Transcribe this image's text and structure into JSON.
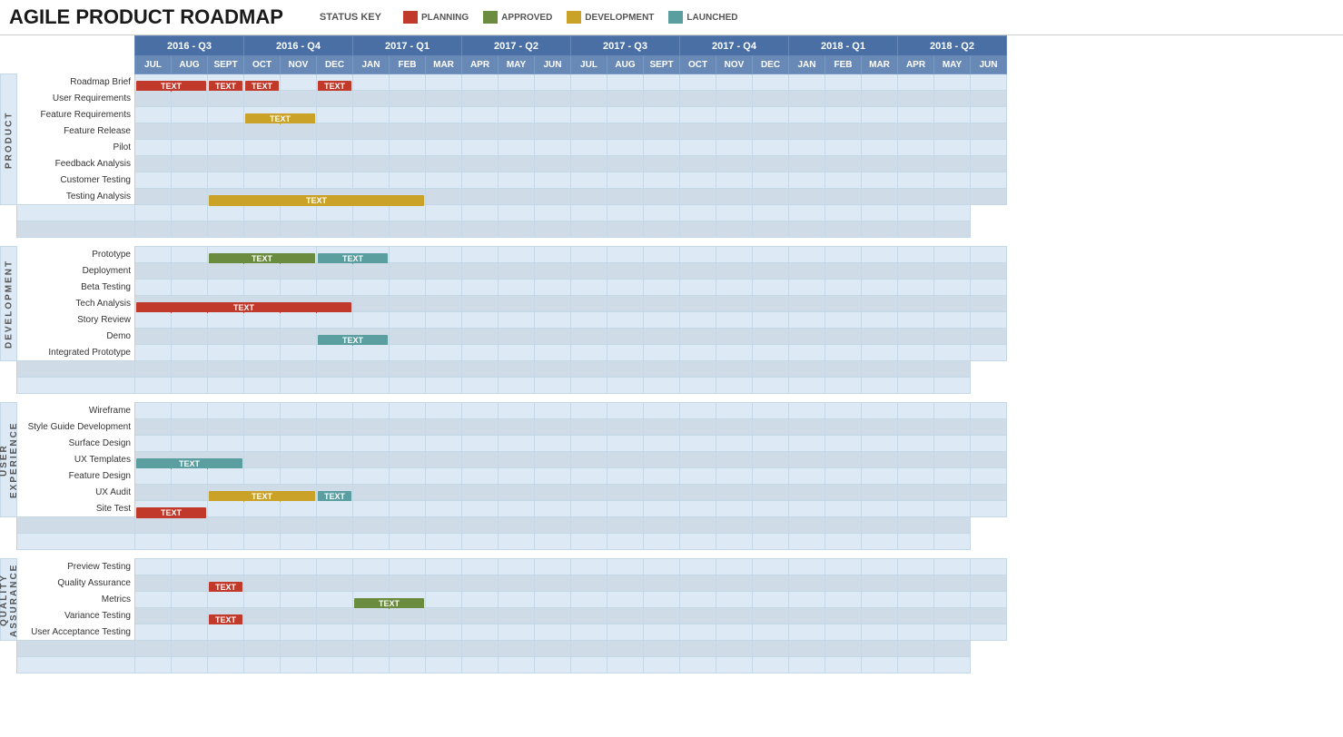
{
  "header": {
    "title": "AGILE PRODUCT ROADMAP",
    "status_key_label": "STATUS KEY",
    "statuses": [
      {
        "name": "planning",
        "label": "PLANNING",
        "color": "#c0392b"
      },
      {
        "name": "approved",
        "label": "APPROVED",
        "color": "#6b8c3e"
      },
      {
        "name": "development",
        "label": "DEVELOPMENT",
        "color": "#c9a227"
      },
      {
        "name": "launched",
        "label": "LAUNCHED",
        "color": "#5b9ea0"
      }
    ]
  },
  "quarters": [
    {
      "label": "2016 - Q3",
      "months": [
        "JUL",
        "AUG",
        "SEPT"
      ],
      "span": 3
    },
    {
      "label": "2016 - Q4",
      "months": [
        "OCT",
        "NOV",
        "DEC"
      ],
      "span": 3
    },
    {
      "label": "2017 - Q1",
      "months": [
        "JAN",
        "FEB",
        "MAR"
      ],
      "span": 3
    },
    {
      "label": "2017 - Q2",
      "months": [
        "APR",
        "MAY",
        "JUN"
      ],
      "span": 3
    },
    {
      "label": "2017 - Q3",
      "months": [
        "JUL",
        "AUG",
        "SEPT"
      ],
      "span": 3
    },
    {
      "label": "2017 - Q4",
      "months": [
        "OCT",
        "NOV",
        "DEC"
      ],
      "span": 3
    },
    {
      "label": "2018 - Q1",
      "months": [
        "JAN",
        "FEB",
        "MAR"
      ],
      "span": 3
    },
    {
      "label": "2018 - Q2",
      "months": [
        "APR",
        "MAY",
        "JUN"
      ],
      "span": 3
    }
  ],
  "sections": [
    {
      "name": "PRODUCT",
      "rows": [
        {
          "label": "Roadmap Brief",
          "bars": [
            {
              "start": 1,
              "span": 2,
              "type": "planning",
              "text": "TEXT"
            },
            {
              "start": 3,
              "span": 1,
              "type": "planning",
              "text": "TEXT"
            },
            {
              "start": 4,
              "span": 1,
              "type": "planning",
              "text": "TEXT"
            },
            {
              "start": 6,
              "span": 1,
              "type": "planning",
              "text": "TEXT"
            }
          ]
        },
        {
          "label": "User Requirements",
          "bars": []
        },
        {
          "label": "Feature Requirements",
          "bars": [
            {
              "start": 4,
              "span": 2,
              "type": "development",
              "text": "TEXT"
            }
          ]
        },
        {
          "label": "Feature Release",
          "bars": []
        },
        {
          "label": "Pilot",
          "bars": []
        },
        {
          "label": "Feedback Analysis",
          "bars": []
        },
        {
          "label": "Customer Testing",
          "bars": []
        },
        {
          "label": "Testing Analysis",
          "bars": [
            {
              "start": 3,
              "span": 6,
              "type": "development",
              "text": "TEXT"
            }
          ]
        }
      ]
    },
    {
      "name": "DEVELOPMENT",
      "rows": [
        {
          "label": "Prototype",
          "bars": [
            {
              "start": 3,
              "span": 3,
              "type": "approved",
              "text": "TEXT"
            },
            {
              "start": 6,
              "span": 2,
              "type": "launched",
              "text": "TEXT"
            }
          ]
        },
        {
          "label": "Deployment",
          "bars": []
        },
        {
          "label": "Beta Testing",
          "bars": []
        },
        {
          "label": "Tech Analysis",
          "bars": [
            {
              "start": 1,
              "span": 6,
              "type": "planning",
              "text": "TEXT"
            }
          ]
        },
        {
          "label": "Story Review",
          "bars": []
        },
        {
          "label": "Demo",
          "bars": [
            {
              "start": 6,
              "span": 2,
              "type": "launched",
              "text": "TEXT"
            }
          ]
        },
        {
          "label": "Integrated Prototype",
          "bars": []
        }
      ]
    },
    {
      "name": "USER EXPERIENCE",
      "rows": [
        {
          "label": "Wireframe",
          "bars": []
        },
        {
          "label": "Style Guide Development",
          "bars": []
        },
        {
          "label": "Surface Design",
          "bars": []
        },
        {
          "label": "UX Templates",
          "bars": [
            {
              "start": 1,
              "span": 3,
              "type": "launched",
              "text": "TEXT"
            }
          ]
        },
        {
          "label": "Feature Design",
          "bars": []
        },
        {
          "label": "UX Audit",
          "bars": [
            {
              "start": 3,
              "span": 3,
              "type": "development",
              "text": "TEXT"
            },
            {
              "start": 6,
              "span": 1,
              "type": "launched",
              "text": "TEXT"
            }
          ]
        },
        {
          "label": "Site Test",
          "bars": [
            {
              "start": 1,
              "span": 2,
              "type": "planning",
              "text": "TEXT"
            }
          ]
        }
      ]
    },
    {
      "name": "QUALITY ASSURANCE",
      "rows": [
        {
          "label": "Preview Testing",
          "bars": []
        },
        {
          "label": "Quality Assurance",
          "bars": [
            {
              "start": 3,
              "span": 1,
              "type": "planning",
              "text": "TEXT"
            }
          ]
        },
        {
          "label": "Metrics",
          "bars": [
            {
              "start": 7,
              "span": 2,
              "type": "approved",
              "text": "TEXT"
            }
          ]
        },
        {
          "label": "Variance Testing",
          "bars": [
            {
              "start": 3,
              "span": 1,
              "type": "planning",
              "text": "TEXT"
            }
          ]
        },
        {
          "label": "User Acceptance Testing",
          "bars": []
        }
      ]
    }
  ]
}
